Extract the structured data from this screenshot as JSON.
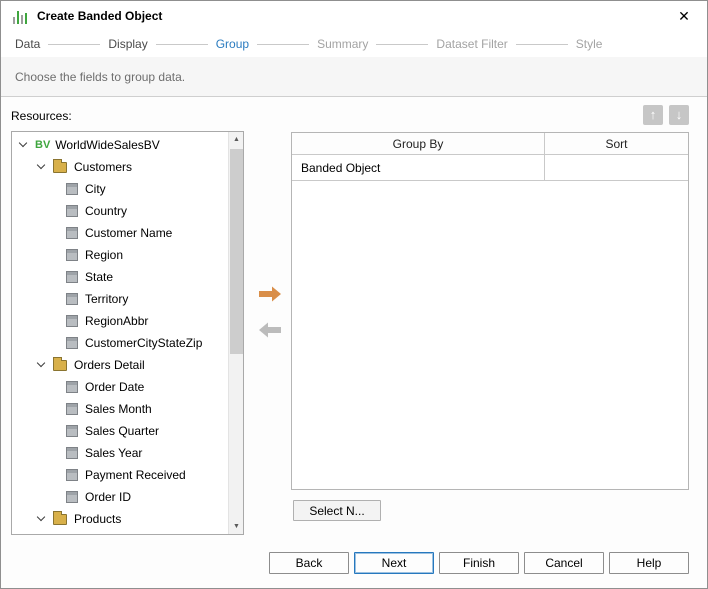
{
  "window": {
    "title": "Create Banded Object",
    "close_glyph": "✕"
  },
  "steps": {
    "items": [
      {
        "label": "Data",
        "state": "done"
      },
      {
        "label": "Display",
        "state": "done"
      },
      {
        "label": "Group",
        "state": "active"
      },
      {
        "label": "Summary",
        "state": "future"
      },
      {
        "label": "Dataset Filter",
        "state": "future"
      },
      {
        "label": "Style",
        "state": "future"
      }
    ]
  },
  "labels": {
    "subtitle": "Choose the fields to group data.",
    "resources": "Resources:"
  },
  "tree": {
    "root": {
      "badge": "BV",
      "label": "WorldWideSalesBV"
    },
    "folders": [
      {
        "label": "Customers",
        "fields": [
          "City",
          "Country",
          "Customer Name",
          "Region",
          "State",
          "Territory",
          "RegionAbbr",
          "CustomerCityStateZip"
        ]
      },
      {
        "label": "Orders Detail",
        "fields": [
          "Order Date",
          "Sales Month",
          "Sales Quarter",
          "Sales Year",
          "Payment Received",
          "Order ID"
        ]
      },
      {
        "label": "Products",
        "fields": []
      }
    ]
  },
  "table": {
    "columns": [
      "Group By",
      "Sort"
    ],
    "rows": [
      {
        "group_by": "Banded Object",
        "sort": ""
      }
    ]
  },
  "actions": {
    "select": "Select N...",
    "back": "Back",
    "next": "Next",
    "finish": "Finish",
    "cancel": "Cancel",
    "help": "Help"
  },
  "icons": {
    "move_up": "↑",
    "move_down": "↓",
    "scroll_up": "▲",
    "scroll_down": "▼"
  },
  "colors": {
    "active_step": "#2b7cc0",
    "arrow_enabled": "#d98e49",
    "arrow_disabled": "#bcbcbc",
    "bv_green": "#3fa63f",
    "folder_yellow": "#d8b04a"
  }
}
